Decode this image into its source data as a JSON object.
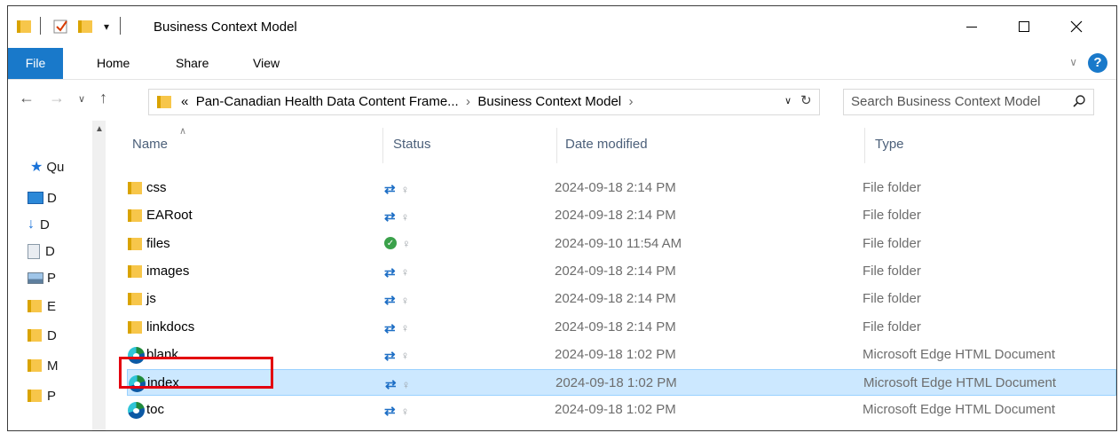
{
  "window": {
    "title": "Business Context Model"
  },
  "ribbon": {
    "tabs": [
      "File",
      "Home",
      "Share",
      "View"
    ],
    "help_label": "?"
  },
  "address": {
    "overflow": "«",
    "crumbs": [
      "Pan-Canadian Health Data Content Frame...",
      "Business Context Model"
    ],
    "search_placeholder": "Search Business Context Model"
  },
  "nav_pane": {
    "items": [
      {
        "label": "Qu",
        "icon": "star-icon"
      },
      {
        "label": "D",
        "icon": "desktop-icon"
      },
      {
        "label": "D",
        "icon": "download-icon"
      },
      {
        "label": "D",
        "icon": "documents-icon"
      },
      {
        "label": "P",
        "icon": "pictures-icon"
      },
      {
        "label": "E",
        "icon": "folder-icon"
      },
      {
        "label": "D",
        "icon": "folder-icon"
      },
      {
        "label": "M",
        "icon": "folder-icon"
      },
      {
        "label": "P",
        "icon": "folder-icon"
      }
    ]
  },
  "columns": {
    "name": "Name",
    "status": "Status",
    "date": "Date modified",
    "type": "Type"
  },
  "files": [
    {
      "name": "css",
      "status": "sync",
      "date": "2024-09-18 2:14 PM",
      "type": "File folder",
      "kind": "folder"
    },
    {
      "name": "EARoot",
      "status": "sync",
      "date": "2024-09-18 2:14 PM",
      "type": "File folder",
      "kind": "folder"
    },
    {
      "name": "files",
      "status": "available",
      "date": "2024-09-10 11:54 AM",
      "type": "File folder",
      "kind": "folder"
    },
    {
      "name": "images",
      "status": "sync",
      "date": "2024-09-18 2:14 PM",
      "type": "File folder",
      "kind": "folder"
    },
    {
      "name": "js",
      "status": "sync",
      "date": "2024-09-18 2:14 PM",
      "type": "File folder",
      "kind": "folder"
    },
    {
      "name": "linkdocs",
      "status": "sync",
      "date": "2024-09-18 2:14 PM",
      "type": "File folder",
      "kind": "folder"
    },
    {
      "name": "blank",
      "status": "sync",
      "date": "2024-09-18 1:02 PM",
      "type": "Microsoft Edge HTML Document",
      "kind": "edge"
    },
    {
      "name": "index",
      "status": "sync",
      "date": "2024-09-18 1:02 PM",
      "type": "Microsoft Edge HTML Document",
      "kind": "edge",
      "selected": true
    },
    {
      "name": "toc",
      "status": "sync",
      "date": "2024-09-18 1:02 PM",
      "type": "Microsoft Edge HTML Document",
      "kind": "edge"
    }
  ],
  "highlight": {
    "target": "index",
    "color": "#e3000f"
  },
  "colors": {
    "accent": "#1979ca",
    "selection": "#cce8ff",
    "sync": "#1d6ec5",
    "available": "#3aa14a"
  }
}
